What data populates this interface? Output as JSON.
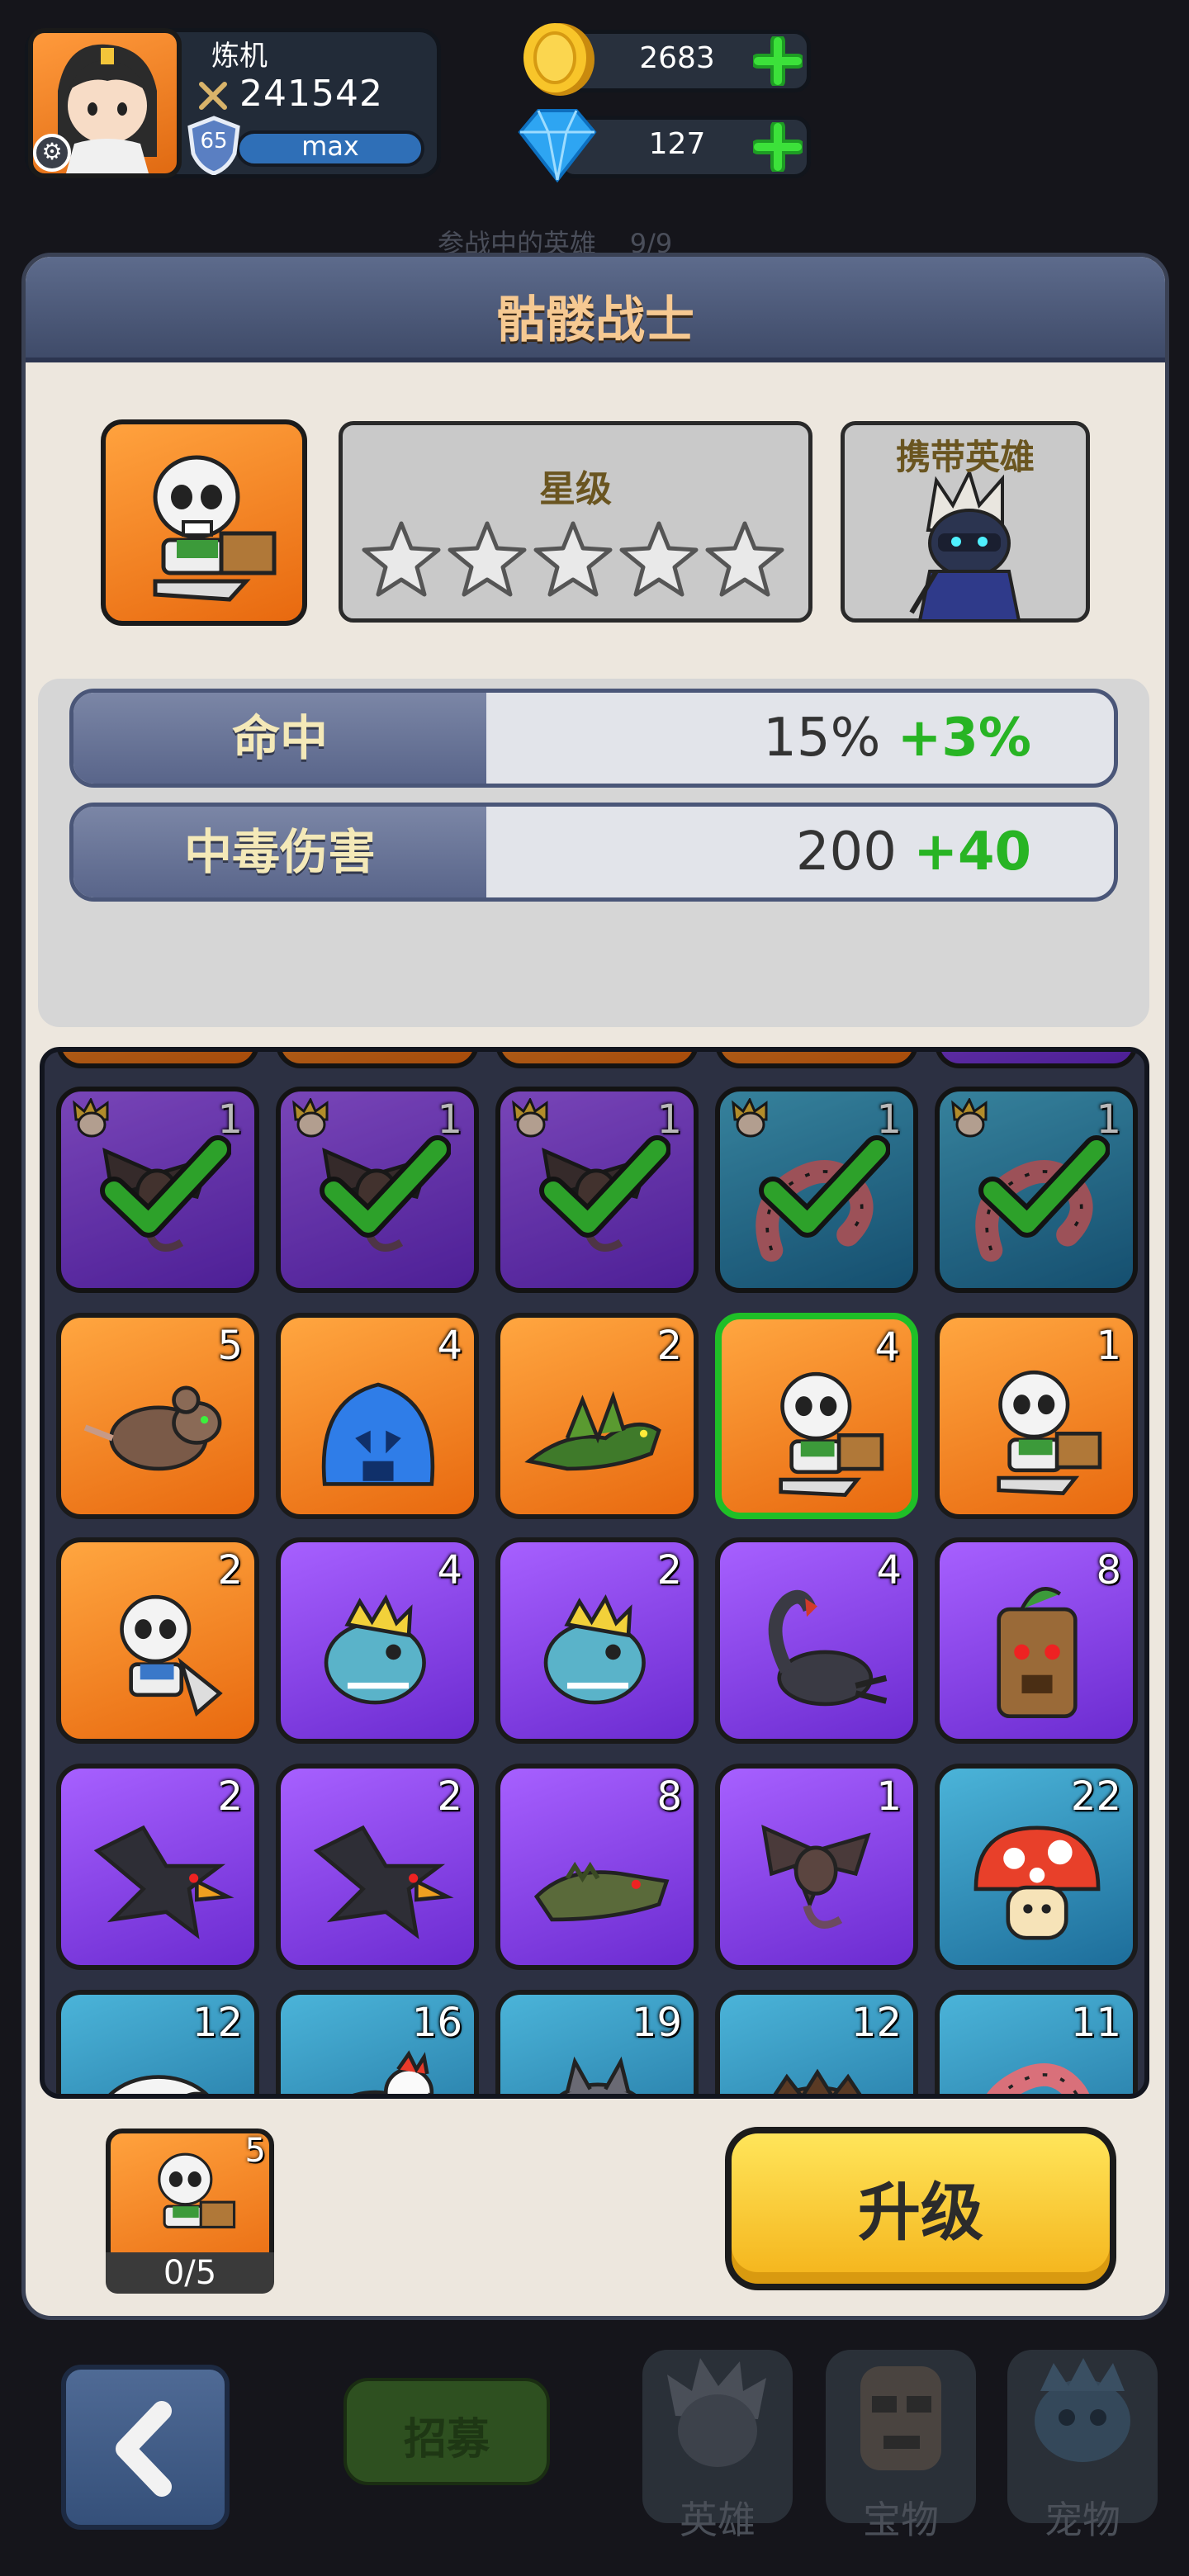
{
  "player": {
    "name": "炼机",
    "power": "241542",
    "level": "65",
    "level_bar": "max"
  },
  "resources": {
    "gold": "2683",
    "gems": "127"
  },
  "background": {
    "peek_label": "参战中的英雄",
    "peek_count": "9/9"
  },
  "modal": {
    "title": "骷髅战士",
    "star_label": "星级",
    "stars_filled": 0,
    "stars_total": 5,
    "carry_label": "携带英雄",
    "stats": [
      {
        "name": "命中",
        "value": "15%",
        "bonus": "+3%"
      },
      {
        "name": "中毒伤害",
        "value": "200",
        "bonus": "+40"
      }
    ]
  },
  "grid": {
    "rows": [
      [
        {
          "color": "purple",
          "count": "1",
          "monster": "bat",
          "used": true
        },
        {
          "color": "purple",
          "count": "1",
          "monster": "bat",
          "used": true
        },
        {
          "color": "purple",
          "count": "1",
          "monster": "bat",
          "used": true
        },
        {
          "color": "blue",
          "count": "1",
          "monster": "worm",
          "used": true
        },
        {
          "color": "blue",
          "count": "1",
          "monster": "worm",
          "used": true
        }
      ],
      [
        {
          "color": "orange",
          "count": "5",
          "monster": "rat"
        },
        {
          "color": "orange",
          "count": "4",
          "monster": "slime"
        },
        {
          "color": "orange",
          "count": "2",
          "monster": "lizard"
        },
        {
          "color": "orange",
          "count": "4",
          "monster": "skeleton",
          "selected": true
        },
        {
          "color": "orange",
          "count": "1",
          "monster": "skeleton"
        }
      ],
      [
        {
          "color": "orange",
          "count": "2",
          "monster": "skeleton-axe"
        },
        {
          "color": "purple",
          "count": "4",
          "monster": "fish"
        },
        {
          "color": "purple",
          "count": "2",
          "monster": "fish"
        },
        {
          "color": "purple",
          "count": "4",
          "monster": "scorpion"
        },
        {
          "color": "purple",
          "count": "8",
          "monster": "treant"
        }
      ],
      [
        {
          "color": "purple",
          "count": "2",
          "monster": "crow"
        },
        {
          "color": "purple",
          "count": "2",
          "monster": "crow"
        },
        {
          "color": "purple",
          "count": "8",
          "monster": "croc"
        },
        {
          "color": "purple",
          "count": "1",
          "monster": "bat"
        },
        {
          "color": "blue",
          "count": "22",
          "monster": "mushroom"
        }
      ],
      [
        {
          "color": "blue",
          "count": "12",
          "monster": "sheep"
        },
        {
          "color": "blue",
          "count": "16",
          "monster": "chicken"
        },
        {
          "color": "blue",
          "count": "19",
          "monster": "wolf"
        },
        {
          "color": "blue",
          "count": "12",
          "monster": "boar"
        },
        {
          "color": "blue",
          "count": "11",
          "monster": "worm"
        }
      ]
    ]
  },
  "material": {
    "count": "5",
    "progress": "0/5"
  },
  "buttons": {
    "upgrade": "升级",
    "recruit": "招募"
  },
  "nav": {
    "heroes": "英雄",
    "treasure": "宝物",
    "pets": "宠物"
  },
  "colors": {
    "accent_gold": "#f6c992",
    "bonus_green": "#28b424",
    "upgrade_yellow": "#f4b31a"
  }
}
